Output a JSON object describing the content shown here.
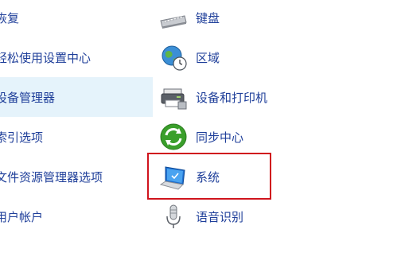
{
  "left_column": [
    {
      "label": "恢复",
      "partial_label": "恢复",
      "icon": "none"
    },
    {
      "label": "轻松使用设置中心",
      "icon": "none"
    },
    {
      "label": "设备管理器",
      "icon": "none",
      "highlighted": true
    },
    {
      "label": "索引选项",
      "icon": "none"
    },
    {
      "label": "文件资源管理器选项",
      "icon": "none"
    },
    {
      "label": "用户帐户",
      "icon": "none"
    }
  ],
  "right_column": [
    {
      "label": "键盘",
      "icon": "keyboard-icon"
    },
    {
      "label": "区域",
      "icon": "globe-clock-icon"
    },
    {
      "label": "设备和打印机",
      "icon": "printer-icon"
    },
    {
      "label": "同步中心",
      "icon": "sync-icon"
    },
    {
      "label": "系统",
      "icon": "laptop-icon",
      "selected": true
    },
    {
      "label": "语音识别",
      "icon": "microphone-icon"
    }
  ],
  "colors": {
    "link_text": "#1f3f9a",
    "highlight_bg": "#e5f3fb",
    "selection_border": "#d0141d",
    "sync_green": "#3a9f2b"
  }
}
